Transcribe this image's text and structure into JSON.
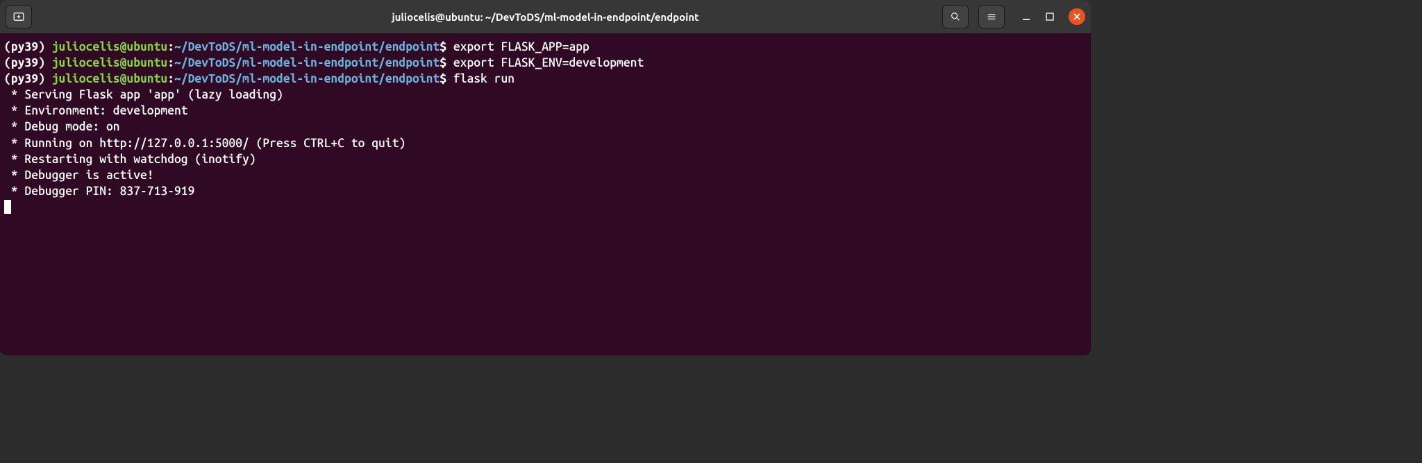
{
  "titlebar": {
    "title": "juliocelis@ubuntu: ~/DevToDS/ml-model-in-endpoint/endpoint"
  },
  "prompt": {
    "env": "(py39) ",
    "userhost": "juliocelis@ubuntu",
    "colon": ":",
    "path": "~/DevToDS/ml-model-in-endpoint/endpoint",
    "dollar": "$"
  },
  "lines": [
    {
      "type": "prompt",
      "command": " export FLASK_APP=app"
    },
    {
      "type": "prompt",
      "command": " export FLASK_ENV=development"
    },
    {
      "type": "prompt",
      "command": " flask run"
    },
    {
      "type": "output",
      "text": " * Serving Flask app 'app' (lazy loading)"
    },
    {
      "type": "output",
      "text": " * Environment: development"
    },
    {
      "type": "output",
      "text": " * Debug mode: on"
    },
    {
      "type": "output",
      "text": " * Running on http://127.0.0.1:5000/ (Press CTRL+C to quit)"
    },
    {
      "type": "output",
      "text": " * Restarting with watchdog (inotify)"
    },
    {
      "type": "output",
      "text": " * Debugger is active!"
    },
    {
      "type": "output",
      "text": " * Debugger PIN: 837-713-919"
    }
  ]
}
